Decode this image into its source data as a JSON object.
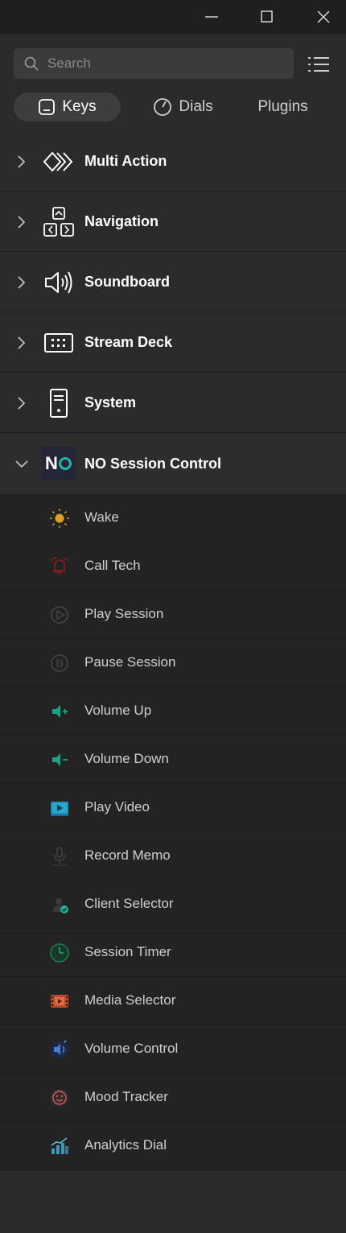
{
  "search": {
    "placeholder": "Search"
  },
  "tabs": [
    {
      "label": "Keys",
      "icon": "key-icon",
      "active": true
    },
    {
      "label": "Dials",
      "icon": "dial-icon",
      "active": false
    },
    {
      "label": "Plugins",
      "icon": "",
      "active": false
    }
  ],
  "categories": [
    {
      "label": "Multi Action",
      "icon": "multi-action-icon",
      "expanded": false
    },
    {
      "label": "Navigation",
      "icon": "navigation-icon",
      "expanded": false
    },
    {
      "label": "Soundboard",
      "icon": "speaker-icon",
      "expanded": false
    },
    {
      "label": "Stream Deck",
      "icon": "stream-deck-icon",
      "expanded": false
    },
    {
      "label": "System",
      "icon": "computer-tower-icon",
      "expanded": false
    },
    {
      "label": "NO Session Control",
      "icon": "no-logo-icon",
      "expanded": true,
      "logo_text": "N"
    }
  ],
  "actions": [
    {
      "label": "Wake",
      "icon": "sun-icon",
      "color": "#e0a020"
    },
    {
      "label": "Call Tech",
      "icon": "alarm-bell-icon",
      "color": "#a02020"
    },
    {
      "label": "Play Session",
      "icon": "play-circle-icon",
      "color": "#444444"
    },
    {
      "label": "Pause Session",
      "icon": "pause-circle-icon",
      "color": "#444444"
    },
    {
      "label": "Volume Up",
      "icon": "volume-up-icon",
      "color": "#20a080"
    },
    {
      "label": "Volume Down",
      "icon": "volume-down-icon",
      "color": "#20a080"
    },
    {
      "label": "Play Video",
      "icon": "video-icon",
      "color": "#2aa0c8"
    },
    {
      "label": "Record Memo",
      "icon": "microphone-icon",
      "color": "#444444"
    },
    {
      "label": "Client Selector",
      "icon": "client-check-icon",
      "color": "#20b090"
    },
    {
      "label": "Session Timer",
      "icon": "timer-icon",
      "color": "#1f7a50"
    },
    {
      "label": "Media Selector",
      "icon": "film-icon",
      "color": "#c05030"
    },
    {
      "label": "Volume Control",
      "icon": "volume-dial-icon",
      "color": "#3a6ac8"
    },
    {
      "label": "Mood Tracker",
      "icon": "smiley-icon",
      "color": "#c06060"
    },
    {
      "label": "Analytics Dial",
      "icon": "analytics-icon",
      "color": "#40a0c0"
    }
  ]
}
